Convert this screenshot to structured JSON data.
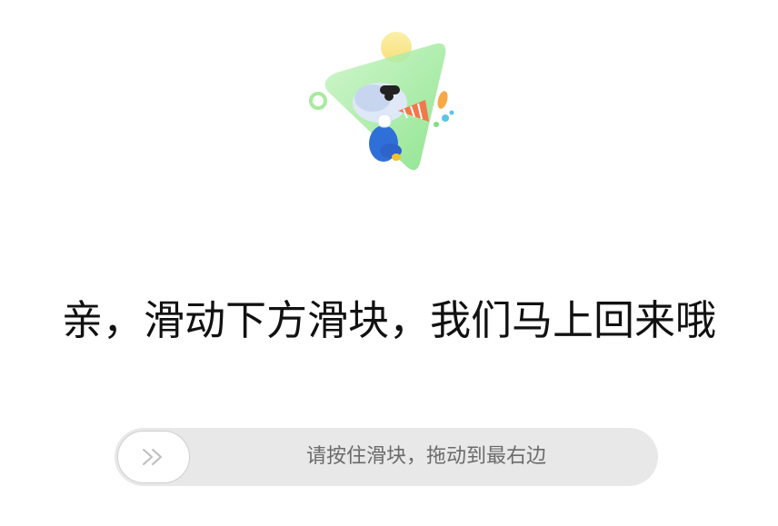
{
  "main": {
    "message": "亲，滑动下方滑块，我们马上回来哦"
  },
  "slider": {
    "hint": "请按住滑块，拖动到最右边",
    "handle_icon": "double-chevron-right-icon"
  },
  "colors": {
    "track": "#e8e8e8",
    "accent_green": "#7fe07f",
    "accent_yellow": "#f9e27a",
    "figure_blue": "#2f6fd8"
  }
}
